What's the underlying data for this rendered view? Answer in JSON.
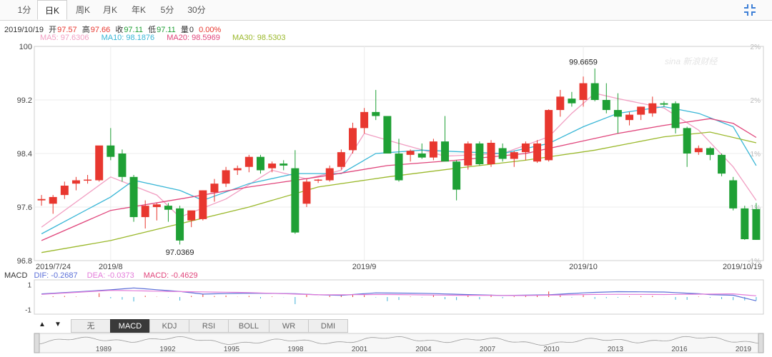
{
  "tabs": [
    {
      "label": "1分",
      "active": false
    },
    {
      "label": "日K",
      "active": true
    },
    {
      "label": "周K",
      "active": false
    },
    {
      "label": "月K",
      "active": false
    },
    {
      "label": "年K",
      "active": false
    },
    {
      "label": "5分",
      "active": false
    },
    {
      "label": "30分",
      "active": false
    }
  ],
  "quote": {
    "date": "2019/10/19",
    "open_label": "开",
    "open": "97.57",
    "high_label": "高",
    "high": "97.66",
    "close_label": "收",
    "close": "97.11",
    "low_label": "低",
    "low": "97.11",
    "vol_label": "量",
    "vol": "0",
    "change": "0.00%"
  },
  "ma_labels": [
    {
      "text": "MA5: 97.6306",
      "color": "#f19ec2"
    },
    {
      "text": "MA10: 98.1876",
      "color": "#38b6d6"
    },
    {
      "text": "MA20: 98.5969",
      "color": "#e0457b"
    },
    {
      "text": "MA30: 98.5303",
      "color": "#9ab82a"
    }
  ],
  "macd_labels": {
    "name": "MACD",
    "dif": "DIF: -0.2687",
    "dea": "DEA: -0.0373",
    "macd": "MACD: -0.4629"
  },
  "indicator_buttons": [
    {
      "label": "无",
      "active": false
    },
    {
      "label": "MACD",
      "active": true
    },
    {
      "label": "KDJ",
      "active": false
    },
    {
      "label": "RSI",
      "active": false
    },
    {
      "label": "BOLL",
      "active": false
    },
    {
      "label": "WR",
      "active": false
    },
    {
      "label": "DMI",
      "active": false
    }
  ],
  "nav_arrows": {
    "up": "▲",
    "down": "▼"
  },
  "watermark": "sina 新浪财经",
  "colors": {
    "up": "#e8372f",
    "down": "#1fa035",
    "ma5": "#f19ec2",
    "ma10": "#38b6d6",
    "ma20": "#e0457b",
    "ma30": "#9ab82a",
    "dif": "#5b6fd8",
    "dea": "#e37ad9"
  },
  "chart_data": {
    "type": "candlestick",
    "price_axis": {
      "ylim": [
        96.8,
        100
      ],
      "ticks": [
        "100",
        "99.2",
        "98.4",
        "97.6",
        "96.8"
      ]
    },
    "percent_axis": {
      "ticks": [
        "2%",
        "2%",
        "1%",
        "1%",
        "-1%"
      ]
    },
    "x_ticks": [
      "2019/7/24",
      "2019/8",
      "2019/9",
      "2019/10",
      "2019/10/19"
    ],
    "x_tick_index": [
      0,
      6,
      28,
      47,
      58
    ],
    "annotations": [
      {
        "text": "99.6659",
        "index": 47,
        "value": 99.6659
      },
      {
        "text": "97.0369",
        "index": 12,
        "value": 97.0369
      }
    ],
    "candles": [
      {
        "o": 97.7,
        "h": 97.78,
        "l": 97.62,
        "c": 97.72
      },
      {
        "o": 97.65,
        "h": 97.78,
        "l": 97.5,
        "c": 97.75
      },
      {
        "o": 97.78,
        "h": 97.98,
        "l": 97.72,
        "c": 97.92
      },
      {
        "o": 97.95,
        "h": 98.05,
        "l": 97.85,
        "c": 98.0
      },
      {
        "o": 98.0,
        "h": 98.08,
        "l": 97.95,
        "c": 98.01
      },
      {
        "o": 98.0,
        "h": 98.4,
        "l": 97.98,
        "c": 98.52
      },
      {
        "o": 98.52,
        "h": 98.78,
        "l": 98.3,
        "c": 98.35
      },
      {
        "o": 98.4,
        "h": 98.46,
        "l": 97.98,
        "c": 98.05
      },
      {
        "o": 98.05,
        "h": 98.08,
        "l": 97.38,
        "c": 97.45
      },
      {
        "o": 97.45,
        "h": 97.7,
        "l": 97.28,
        "c": 97.62
      },
      {
        "o": 97.6,
        "h": 97.66,
        "l": 97.4,
        "c": 97.64
      },
      {
        "o": 97.62,
        "h": 97.66,
        "l": 97.38,
        "c": 97.56
      },
      {
        "o": 97.58,
        "h": 97.62,
        "l": 97.04,
        "c": 97.1
      },
      {
        "o": 97.4,
        "h": 97.52,
        "l": 97.3,
        "c": 97.55
      },
      {
        "o": 97.42,
        "h": 97.85,
        "l": 97.4,
        "c": 97.85
      },
      {
        "o": 97.82,
        "h": 98.02,
        "l": 97.68,
        "c": 97.95
      },
      {
        "o": 97.95,
        "h": 98.2,
        "l": 97.9,
        "c": 98.15
      },
      {
        "o": 98.15,
        "h": 98.22,
        "l": 98.08,
        "c": 98.18
      },
      {
        "o": 98.2,
        "h": 98.38,
        "l": 98.12,
        "c": 98.35
      },
      {
        "o": 98.35,
        "h": 98.38,
        "l": 98.1,
        "c": 98.15
      },
      {
        "o": 98.18,
        "h": 98.28,
        "l": 98.12,
        "c": 98.25
      },
      {
        "o": 98.25,
        "h": 98.3,
        "l": 98.15,
        "c": 98.22
      },
      {
        "o": 98.18,
        "h": 98.45,
        "l": 97.2,
        "c": 97.22
      },
      {
        "o": 97.65,
        "h": 98.02,
        "l": 97.6,
        "c": 97.98
      },
      {
        "o": 98.0,
        "h": 98.02,
        "l": 97.96,
        "c": 98.01
      },
      {
        "o": 98.0,
        "h": 98.22,
        "l": 97.98,
        "c": 98.18
      },
      {
        "o": 98.2,
        "h": 98.46,
        "l": 98.16,
        "c": 98.42
      },
      {
        "o": 98.45,
        "h": 98.86,
        "l": 98.4,
        "c": 98.78
      },
      {
        "o": 98.78,
        "h": 99.08,
        "l": 98.7,
        "c": 99.02
      },
      {
        "o": 99.02,
        "h": 99.35,
        "l": 98.9,
        "c": 98.96
      },
      {
        "o": 98.96,
        "h": 98.96,
        "l": 98.4,
        "c": 98.4
      },
      {
        "o": 98.4,
        "h": 98.62,
        "l": 97.98,
        "c": 98.0
      },
      {
        "o": 98.38,
        "h": 98.46,
        "l": 98.28,
        "c": 98.44
      },
      {
        "o": 98.4,
        "h": 98.55,
        "l": 98.32,
        "c": 98.34
      },
      {
        "o": 98.34,
        "h": 98.62,
        "l": 98.3,
        "c": 98.58
      },
      {
        "o": 98.58,
        "h": 98.96,
        "l": 98.32,
        "c": 98.28
      },
      {
        "o": 98.28,
        "h": 98.3,
        "l": 97.7,
        "c": 97.86
      },
      {
        "o": 98.22,
        "h": 98.58,
        "l": 98.16,
        "c": 98.55
      },
      {
        "o": 98.55,
        "h": 98.58,
        "l": 98.22,
        "c": 98.24
      },
      {
        "o": 98.24,
        "h": 98.6,
        "l": 98.2,
        "c": 98.56
      },
      {
        "o": 98.48,
        "h": 98.55,
        "l": 98.28,
        "c": 98.32
      },
      {
        "o": 98.32,
        "h": 98.44,
        "l": 98.2,
        "c": 98.42
      },
      {
        "o": 98.42,
        "h": 98.58,
        "l": 98.3,
        "c": 98.55
      },
      {
        "o": 98.28,
        "h": 98.6,
        "l": 98.26,
        "c": 98.55
      },
      {
        "o": 98.3,
        "h": 99.06,
        "l": 98.28,
        "c": 99.05
      },
      {
        "o": 99.05,
        "h": 99.35,
        "l": 98.95,
        "c": 99.25
      },
      {
        "o": 99.22,
        "h": 99.32,
        "l": 99.1,
        "c": 99.15
      },
      {
        "o": 99.2,
        "h": 99.55,
        "l": 99.1,
        "c": 99.45
      },
      {
        "o": 99.45,
        "h": 99.67,
        "l": 99.18,
        "c": 99.2
      },
      {
        "o": 99.2,
        "h": 99.45,
        "l": 99.0,
        "c": 99.05
      },
      {
        "o": 99.05,
        "h": 99.3,
        "l": 98.7,
        "c": 98.95
      },
      {
        "o": 98.9,
        "h": 99.02,
        "l": 98.82,
        "c": 98.98
      },
      {
        "o": 98.98,
        "h": 99.1,
        "l": 98.9,
        "c": 99.1
      },
      {
        "o": 99.0,
        "h": 99.25,
        "l": 98.95,
        "c": 99.15
      },
      {
        "o": 99.15,
        "h": 99.18,
        "l": 99.1,
        "c": 99.13
      },
      {
        "o": 99.15,
        "h": 99.18,
        "l": 98.7,
        "c": 98.78
      },
      {
        "o": 98.78,
        "h": 98.8,
        "l": 98.2,
        "c": 98.4
      },
      {
        "o": 98.42,
        "h": 98.52,
        "l": 98.38,
        "c": 98.48
      },
      {
        "o": 98.48,
        "h": 98.5,
        "l": 98.3,
        "c": 98.38
      },
      {
        "o": 98.38,
        "h": 98.4,
        "l": 98.06,
        "c": 98.1
      },
      {
        "o": 98.0,
        "h": 98.05,
        "l": 97.55,
        "c": 97.58
      },
      {
        "o": 97.58,
        "h": 97.62,
        "l": 97.11,
        "c": 97.12
      },
      {
        "o": 97.57,
        "h": 97.66,
        "l": 97.11,
        "c": 97.11
      }
    ],
    "series": [
      {
        "name": "MA5",
        "points": [
          [
            0,
            97.3
          ],
          [
            6,
            98.05
          ],
          [
            10,
            97.78
          ],
          [
            12,
            97.45
          ],
          [
            16,
            97.72
          ],
          [
            20,
            98.15
          ],
          [
            23,
            98.02
          ],
          [
            26,
            98.15
          ],
          [
            28,
            98.7
          ],
          [
            31,
            98.55
          ],
          [
            35,
            98.36
          ],
          [
            40,
            98.4
          ],
          [
            44,
            98.65
          ],
          [
            46,
            99.0
          ],
          [
            48,
            99.3
          ],
          [
            50,
            99.22
          ],
          [
            54,
            99.08
          ],
          [
            57,
            98.75
          ],
          [
            60,
            98.2
          ],
          [
            62,
            97.7
          ]
        ]
      },
      {
        "name": "MA10",
        "points": [
          [
            0,
            97.2
          ],
          [
            6,
            97.75
          ],
          [
            8,
            98.0
          ],
          [
            12,
            97.85
          ],
          [
            14,
            97.7
          ],
          [
            18,
            97.95
          ],
          [
            22,
            98.1
          ],
          [
            26,
            98.1
          ],
          [
            29,
            98.4
          ],
          [
            33,
            98.45
          ],
          [
            40,
            98.4
          ],
          [
            44,
            98.55
          ],
          [
            47,
            98.8
          ],
          [
            50,
            99.0
          ],
          [
            54,
            99.1
          ],
          [
            57,
            99.0
          ],
          [
            60,
            98.8
          ],
          [
            62,
            98.22
          ]
        ]
      },
      {
        "name": "MA20",
        "points": [
          [
            0,
            97.1
          ],
          [
            6,
            97.55
          ],
          [
            12,
            97.72
          ],
          [
            18,
            97.9
          ],
          [
            24,
            98.05
          ],
          [
            30,
            98.22
          ],
          [
            36,
            98.3
          ],
          [
            42,
            98.4
          ],
          [
            46,
            98.55
          ],
          [
            50,
            98.7
          ],
          [
            54,
            98.82
          ],
          [
            58,
            98.92
          ],
          [
            60,
            98.85
          ],
          [
            62,
            98.64
          ]
        ]
      },
      {
        "name": "MA30",
        "points": [
          [
            0,
            96.92
          ],
          [
            6,
            97.1
          ],
          [
            12,
            97.35
          ],
          [
            18,
            97.6
          ],
          [
            24,
            97.9
          ],
          [
            30,
            98.05
          ],
          [
            36,
            98.18
          ],
          [
            42,
            98.3
          ],
          [
            48,
            98.45
          ],
          [
            54,
            98.65
          ],
          [
            58,
            98.72
          ],
          [
            62,
            98.56
          ]
        ]
      }
    ],
    "macd_panel": {
      "ylim": [
        -1,
        1
      ],
      "ticks": [
        "1",
        "-1"
      ]
    }
  }
}
